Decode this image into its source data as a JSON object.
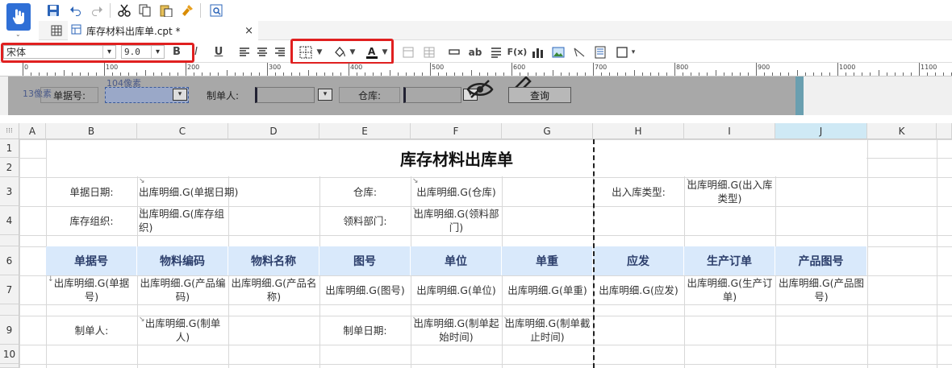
{
  "toolbar": {
    "icons": [
      "save-icon",
      "undo-icon",
      "redo-icon",
      "cut-icon",
      "copy-icon",
      "paste-icon",
      "format-brush-icon",
      "preview-icon"
    ]
  },
  "tab": {
    "title": "库存材料出库单.cpt *",
    "close": "×"
  },
  "format": {
    "font_name": "宋体",
    "font_size": "9.0",
    "bold": "B",
    "italic": "I",
    "underline": "U",
    "text_label": "ab",
    "formula": "F(x)"
  },
  "colors": {
    "highlight": "#e02020",
    "header_bg": "#d9e9fb",
    "param_bg": "#a8a8a8"
  },
  "ruler": {
    "ticks": [
      "0",
      "100",
      "200",
      "300",
      "400",
      "500",
      "600",
      "700",
      "800",
      "900",
      "1000",
      "1100"
    ]
  },
  "params": {
    "px13": "13像素",
    "px104": "104像素",
    "danju_label": "单据号:",
    "zhidan_label": "制单人:",
    "cangku_label": "仓库:",
    "query": "查询"
  },
  "columns": [
    "A",
    "B",
    "C",
    "D",
    "E",
    "F",
    "G",
    "H",
    "I",
    "J",
    "K"
  ],
  "rows": [
    "1",
    "2",
    "3",
    "4",
    "6",
    "7",
    "9",
    "10"
  ],
  "report": {
    "title": "库存材料出库单",
    "r3": {
      "b": "单据日期:",
      "c": "出库明细.G(单据日期)",
      "e": "仓库:",
      "f": "出库明细.G(仓库)",
      "h": "出入库类型:",
      "i": "出库明细.G(出入库类型)"
    },
    "r4": {
      "b": "库存组织:",
      "c": "出库明细.G(库存组织)",
      "e": "领料部门:",
      "f": "出库明细.G(领料部门)"
    },
    "headers": [
      "单据号",
      "物料编码",
      "物料名称",
      "图号",
      "单位",
      "单重",
      "应发",
      "生产订单",
      "产品图号"
    ],
    "data": [
      "出库明细.G(单据号)",
      "出库明细.G(产品编码)",
      "出库明细.G(产品名称)",
      "出库明细.G(图号)",
      "出库明细.G(单位)",
      "出库明细.G(单重)",
      "出库明细.G(应发)",
      "出库明细.G(生产订单)",
      "出库明细.G(产品图号)"
    ],
    "r9": {
      "b": "制单人:",
      "c": "出库明细.G(制单人)",
      "e": "制单日期:",
      "f": "出库明细.G(制单起始时间)",
      "g": "出库明细.G(制单截止时间)"
    }
  }
}
